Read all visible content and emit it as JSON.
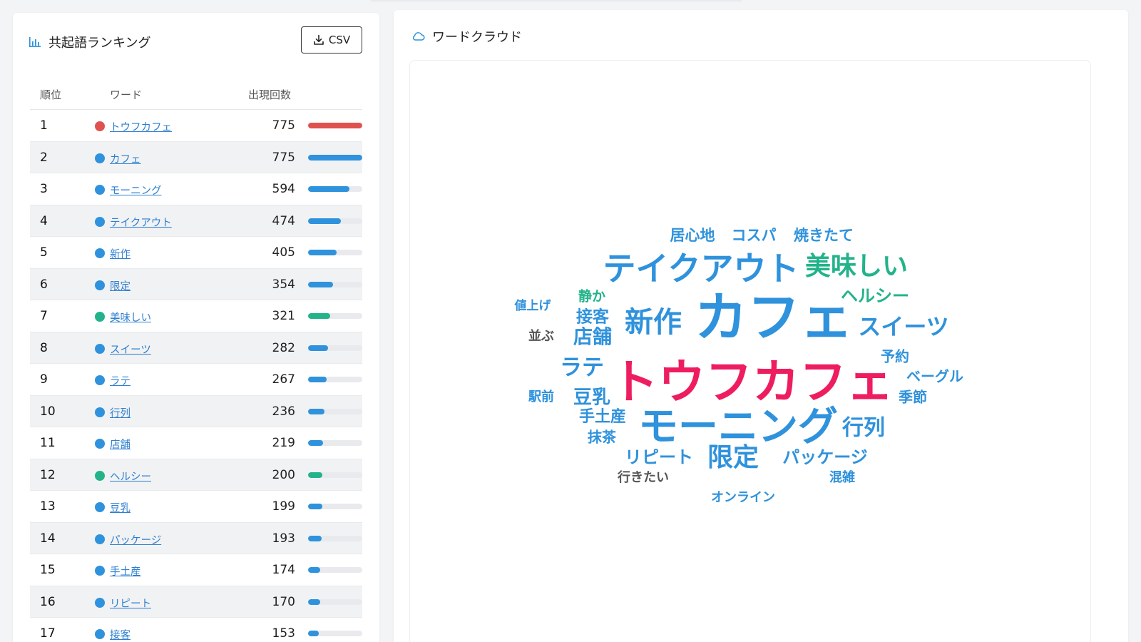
{
  "ranking": {
    "title": "共起語ランキング",
    "csv_label": "CSV",
    "headers": {
      "rank": "順位",
      "word": "ワード",
      "count": "出現回数"
    },
    "rows": [
      {
        "rank": "1",
        "word": "トウフカフェ",
        "count": 775,
        "color": "#e0524f"
      },
      {
        "rank": "2",
        "word": "カフェ",
        "count": 775,
        "color": "#2f92dc"
      },
      {
        "rank": "3",
        "word": "モーニング",
        "count": 594,
        "color": "#2f92dc"
      },
      {
        "rank": "4",
        "word": "テイクアウト",
        "count": 474,
        "color": "#2f92dc"
      },
      {
        "rank": "5",
        "word": "新作",
        "count": 405,
        "color": "#2f92dc"
      },
      {
        "rank": "6",
        "word": "限定",
        "count": 354,
        "color": "#2f92dc"
      },
      {
        "rank": "7",
        "word": "美味しい",
        "count": 321,
        "color": "#22b38a"
      },
      {
        "rank": "8",
        "word": "スイーツ",
        "count": 282,
        "color": "#2f92dc"
      },
      {
        "rank": "9",
        "word": "ラテ",
        "count": 267,
        "color": "#2f92dc"
      },
      {
        "rank": "10",
        "word": "行列",
        "count": 236,
        "color": "#2f92dc"
      },
      {
        "rank": "11",
        "word": "店舗",
        "count": 219,
        "color": "#2f92dc"
      },
      {
        "rank": "12",
        "word": "ヘルシー",
        "count": 200,
        "color": "#22b38a"
      },
      {
        "rank": "13",
        "word": "豆乳",
        "count": 199,
        "color": "#2f92dc"
      },
      {
        "rank": "14",
        "word": "パッケージ",
        "count": 193,
        "color": "#2f92dc"
      },
      {
        "rank": "15",
        "word": "手土産",
        "count": 174,
        "color": "#2f92dc"
      },
      {
        "rank": "16",
        "word": "リピート",
        "count": 170,
        "color": "#2f92dc"
      },
      {
        "rank": "17",
        "word": "接客",
        "count": 153,
        "color": "#2f92dc"
      }
    ],
    "max_count": 775
  },
  "wordcloud": {
    "title": "ワードクラウド",
    "words": [
      {
        "text": "居心地",
        "color": "#2f92dc"
      },
      {
        "text": "コスパ",
        "color": "#2f92dc"
      },
      {
        "text": "焼きたて",
        "color": "#2f92dc"
      },
      {
        "text": "テイクアウト",
        "color": "#2f92dc"
      },
      {
        "text": "美味しい",
        "color": "#22b38a"
      },
      {
        "text": "静か",
        "color": "#22b38a"
      },
      {
        "text": "値上げ",
        "color": "#2f92dc"
      },
      {
        "text": "カフェ",
        "color": "#2f92dc"
      },
      {
        "text": "ヘルシー",
        "color": "#22b38a"
      },
      {
        "text": "接客",
        "color": "#2f92dc"
      },
      {
        "text": "新作",
        "color": "#2f92dc"
      },
      {
        "text": "スイーツ",
        "color": "#2f92dc"
      },
      {
        "text": "並ぶ",
        "color": "#555555"
      },
      {
        "text": "店舗",
        "color": "#2f92dc"
      },
      {
        "text": "予約",
        "color": "#2f92dc"
      },
      {
        "text": "ラテ",
        "color": "#2f92dc"
      },
      {
        "text": "トウフカフェ",
        "color": "#ee1d5f"
      },
      {
        "text": "ベーグル",
        "color": "#2f92dc"
      },
      {
        "text": "駅前",
        "color": "#2f92dc"
      },
      {
        "text": "豆乳",
        "color": "#2f92dc"
      },
      {
        "text": "季節",
        "color": "#2f92dc"
      },
      {
        "text": "手土産",
        "color": "#2f92dc"
      },
      {
        "text": "モーニング",
        "color": "#2f92dc"
      },
      {
        "text": "行列",
        "color": "#2f92dc"
      },
      {
        "text": "抹茶",
        "color": "#2f92dc"
      },
      {
        "text": "リピート",
        "color": "#2f92dc"
      },
      {
        "text": "限定",
        "color": "#2f92dc"
      },
      {
        "text": "パッケージ",
        "color": "#2f92dc"
      },
      {
        "text": "行きたい",
        "color": "#555555"
      },
      {
        "text": "混雑",
        "color": "#2f92dc"
      },
      {
        "text": "オンライン",
        "color": "#2f92dc"
      }
    ]
  }
}
